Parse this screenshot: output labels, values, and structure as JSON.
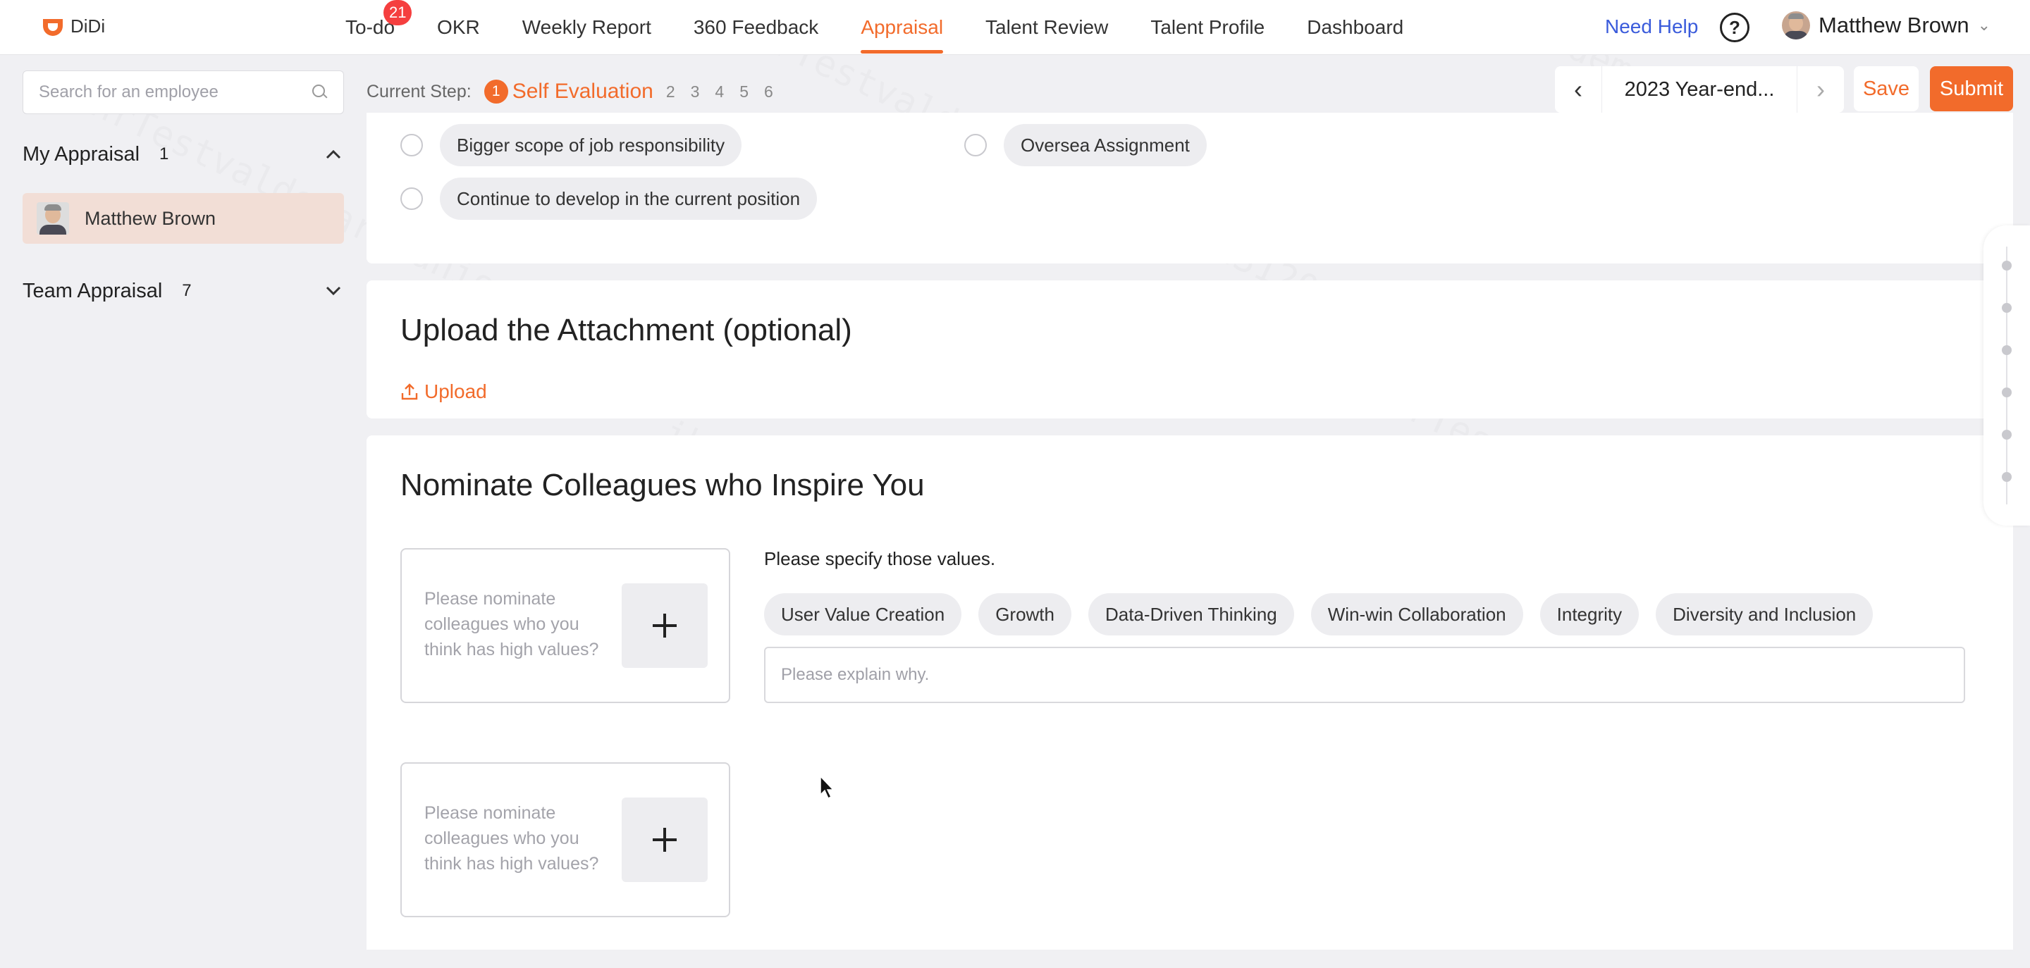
{
  "brand": {
    "logo_text": "DiDi"
  },
  "nav": {
    "items": [
      {
        "label": "To-do",
        "badge": "21"
      },
      {
        "label": "OKR"
      },
      {
        "label": "Weekly Report"
      },
      {
        "label": "360 Feedback"
      },
      {
        "label": "Appraisal",
        "active": true
      },
      {
        "label": "Talent Review"
      },
      {
        "label": "Talent Profile"
      },
      {
        "label": "Dashboard"
      }
    ],
    "need_help": "Need Help",
    "help_icon": "question-circle-icon",
    "user_name": "Matthew Brown"
  },
  "sidebar": {
    "search_placeholder": "Search for an employee",
    "my_appraisal": {
      "label": "My Appraisal",
      "count": "1",
      "expanded": true
    },
    "selected_employee": "Matthew Brown",
    "team_appraisal": {
      "label": "Team Appraisal",
      "count": "7",
      "expanded": false
    }
  },
  "steps": {
    "label": "Current Step:",
    "current_number": "1",
    "current_name": "Self Evaluation",
    "others": [
      "2",
      "3",
      "4",
      "5",
      "6"
    ]
  },
  "period": {
    "label": "2023 Year-end..."
  },
  "actions": {
    "save": "Save",
    "submit": "Submit"
  },
  "development": {
    "options": [
      "Bigger scope of job responsibility",
      "Oversea Assignment",
      "Continue to develop in the current position"
    ]
  },
  "attachment": {
    "title": "Upload the Attachment (optional)",
    "upload_label": "Upload"
  },
  "nominate": {
    "title": "Nominate Colleagues who Inspire You",
    "slot_placeholder": "Please nominate colleagues who you think has high values?",
    "values_label": "Please specify those values.",
    "values": [
      "User Value Creation",
      "Growth",
      "Data-Driven Thinking",
      "Win-win Collaboration",
      "Integrity",
      "Diversity and Inclusion"
    ],
    "explain_placeholder": "Please explain why."
  },
  "colors": {
    "accent": "#f26b2b",
    "link": "#3a5bdb",
    "badge": "#f53f3f"
  }
}
